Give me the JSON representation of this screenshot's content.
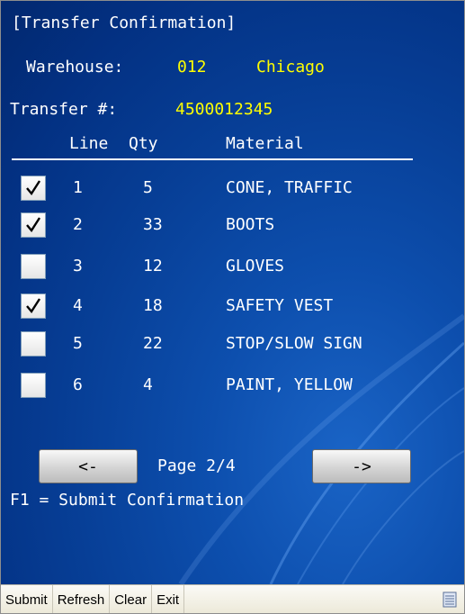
{
  "screen": {
    "title": "[Transfer Confirmation]",
    "warehouse_label": "Warehouse:",
    "warehouse_code": "012",
    "warehouse_city": "Chicago",
    "transfer_label": "Transfer #:",
    "transfer_number": "4500012345",
    "columns": {
      "line": "Line",
      "qty": "Qty",
      "material": "Material"
    },
    "rows": [
      {
        "line": "1",
        "qty": "5",
        "material": "CONE, TRAFFIC",
        "checked": true
      },
      {
        "line": "2",
        "qty": "33",
        "material": "BOOTS",
        "checked": true
      },
      {
        "line": "3",
        "qty": "12",
        "material": "GLOVES",
        "checked": false
      },
      {
        "line": "4",
        "qty": "18",
        "material": "SAFETY VEST",
        "checked": true
      },
      {
        "line": "5",
        "qty": "22",
        "material": "STOP/SLOW SIGN",
        "checked": false
      },
      {
        "line": "6",
        "qty": "4",
        "material": "PAINT, YELLOW",
        "checked": false
      }
    ],
    "prev_label": "<-",
    "page_label": "Page 2/4",
    "next_label": "->",
    "hint": "F1 = Submit Confirmation"
  },
  "menubar": {
    "submit": "Submit",
    "refresh": "Refresh",
    "clear": "Clear",
    "exit": "Exit"
  },
  "colors": {
    "background": "#0a47a3",
    "text": "#ffffff",
    "highlight": "#ffff00"
  }
}
